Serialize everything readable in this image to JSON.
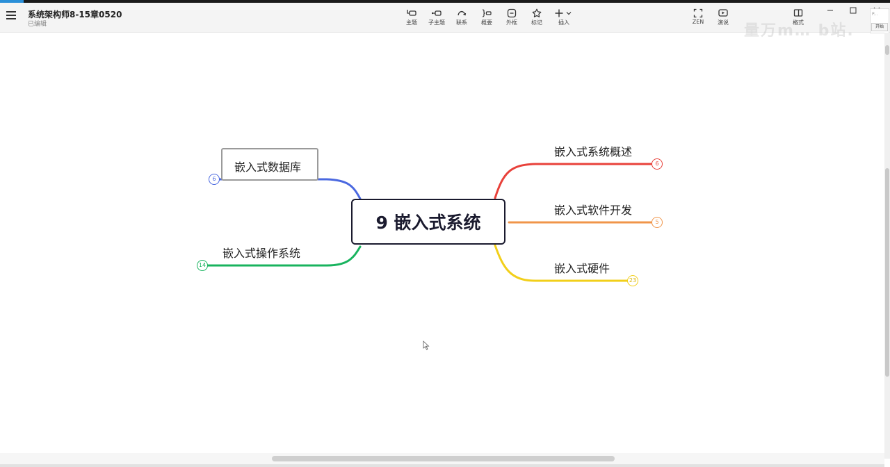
{
  "header": {
    "doc_title": "系统架构师8-15章0520",
    "doc_status": "已编辑"
  },
  "toolbar": {
    "tools": [
      {
        "label": "主题",
        "icon": "topic-icon"
      },
      {
        "label": "子主题",
        "icon": "subtopic-icon"
      },
      {
        "label": "联系",
        "icon": "relationship-icon"
      },
      {
        "label": "概要",
        "icon": "summary-icon"
      },
      {
        "label": "外框",
        "icon": "boundary-icon"
      },
      {
        "label": "标记",
        "icon": "star-icon"
      },
      {
        "label": "插入",
        "icon": "plus-icon"
      }
    ],
    "right_tools": [
      {
        "label": "ZEN",
        "icon": "fullscreen-icon"
      },
      {
        "label": "演说",
        "icon": "play-icon"
      },
      {
        "label": "格式",
        "icon": "panel-icon"
      }
    ]
  },
  "side_panel": {
    "thumb_text": "P...",
    "open_label": "开始"
  },
  "watermark": "量万m… b站.",
  "mindmap": {
    "root": "9 嵌入式系统",
    "branches": [
      {
        "label": "嵌入式系统概述",
        "count": "6",
        "color": "#e8413a"
      },
      {
        "label": "嵌入式软件开发",
        "count": "5",
        "color": "#f0954a"
      },
      {
        "label": "嵌入式硬件",
        "count": "23",
        "color": "#f2cf1a"
      },
      {
        "label": "嵌入式数据库",
        "count": "6",
        "color": "#4a68e0"
      },
      {
        "label": "嵌入式操作系统",
        "count": "14",
        "color": "#18b35e"
      }
    ]
  }
}
